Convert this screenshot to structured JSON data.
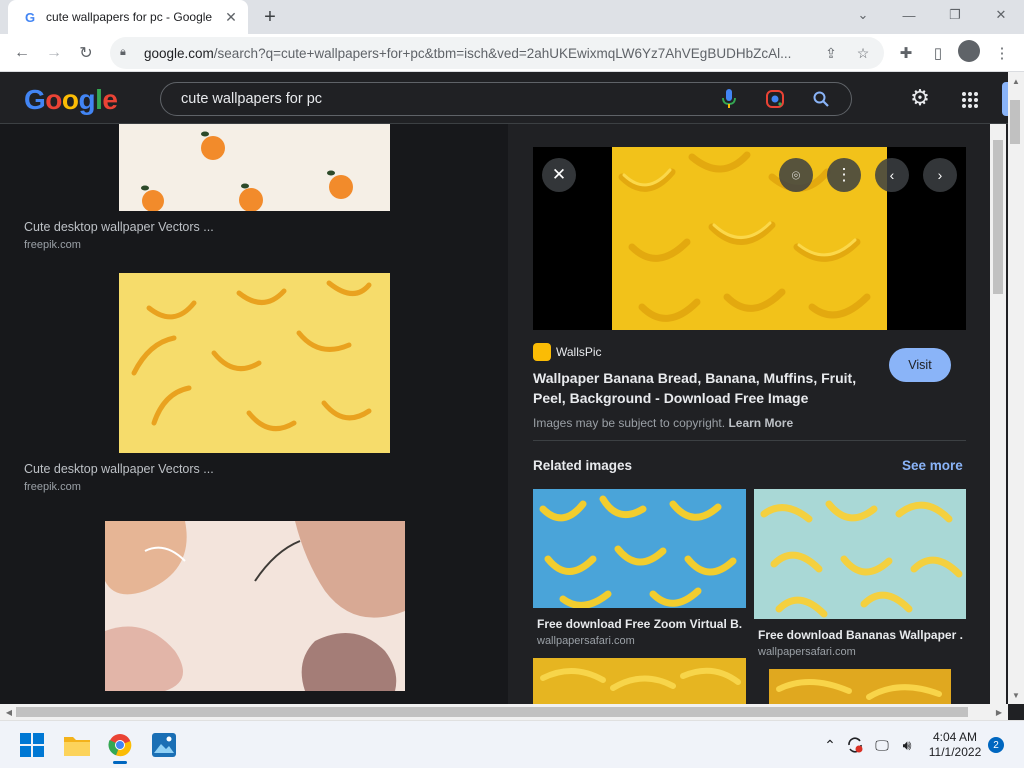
{
  "browser": {
    "tab_title": "cute wallpapers for pc - Google ",
    "tab_favicon": "G",
    "url_host": "google.com",
    "url_path": "/search?q=cute+wallpapers+for+pc&tbm=isch&ved=2ahUKEwixmqLW6Yz7AhVEgBUDHbZcAl..."
  },
  "google": {
    "logo": [
      "G",
      "o",
      "o",
      "g",
      "l",
      "e"
    ],
    "logo_colors": [
      "#4285f4",
      "#ea4335",
      "#fbbc05",
      "#4285f4",
      "#34a853",
      "#ea4335"
    ],
    "query": "cute wallpapers for pc"
  },
  "results": [
    {
      "title": "Cute desktop wallpaper Vectors ...",
      "source": "freepik.com"
    },
    {
      "title": "Cute desktop wallpaper Vectors ...",
      "source": "freepik.com"
    }
  ],
  "preview": {
    "source_name": "WallsPic",
    "visit_label": "Visit",
    "title": "Wallpaper Banana Bread, Banana, Muffins, Fruit, Peel, Background - Download Free Image",
    "copyright_text": "Images may be subject to copyright.",
    "learn_more": "Learn More",
    "related_title": "Related images",
    "see_more": "See more"
  },
  "related": [
    {
      "title": "Free download Free Zoom Virtual B...",
      "source": "wallpapersafari.com"
    },
    {
      "title": "Free download Bananas Wallpaper ...",
      "source": "wallpapersafari.com"
    }
  ],
  "taskbar": {
    "time": "4:04 AM",
    "date": "11/1/2022",
    "notifications": "2"
  },
  "colors": {
    "accent_blue": "#8ab4f8",
    "dark_bg": "#202124",
    "banana_yellow": "#f3c623"
  }
}
